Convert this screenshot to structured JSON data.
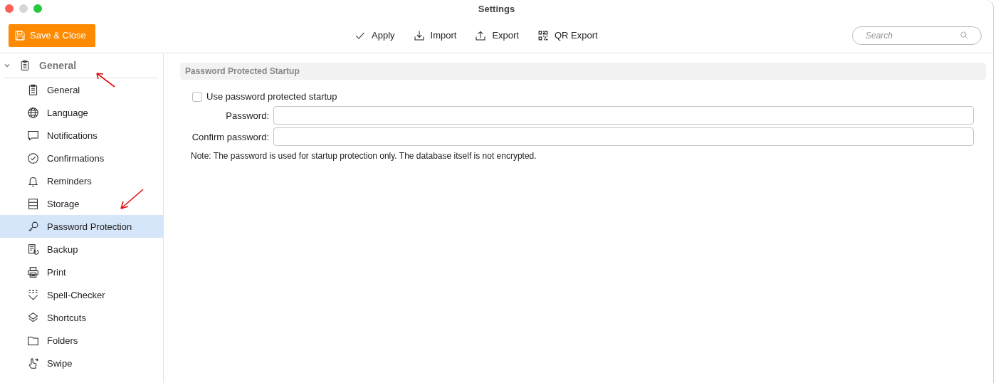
{
  "window": {
    "title": "Settings"
  },
  "toolbar": {
    "primary_button": "Save & Close",
    "actions": [
      {
        "label": "Apply"
      },
      {
        "label": "Import"
      },
      {
        "label": "Export"
      },
      {
        "label": "QR Export"
      }
    ],
    "search": {
      "placeholder": "Search"
    }
  },
  "sidebar": {
    "group": {
      "label": "General",
      "expanded": true,
      "children": [
        {
          "label": "General",
          "selected": false
        },
        {
          "label": "Language",
          "selected": false
        },
        {
          "label": "Notifications",
          "selected": false
        },
        {
          "label": "Confirmations",
          "selected": false
        },
        {
          "label": "Reminders",
          "selected": false
        },
        {
          "label": "Storage",
          "selected": false
        },
        {
          "label": "Password Protection",
          "selected": true
        },
        {
          "label": "Backup",
          "selected": false
        },
        {
          "label": "Print",
          "selected": false
        },
        {
          "label": "Spell-Checker",
          "selected": false
        },
        {
          "label": "Shortcuts",
          "selected": false
        },
        {
          "label": "Folders",
          "selected": false
        },
        {
          "label": "Swipe",
          "selected": false
        }
      ]
    }
  },
  "content": {
    "section_title": "Password Protected Startup",
    "checkbox": {
      "label": "Use password protected startup",
      "checked": false
    },
    "fields": [
      {
        "label": "Password:"
      },
      {
        "label": "Confirm password:"
      }
    ],
    "note": "Note: The password is used for startup protection only. The database itself is not encrypted."
  }
}
